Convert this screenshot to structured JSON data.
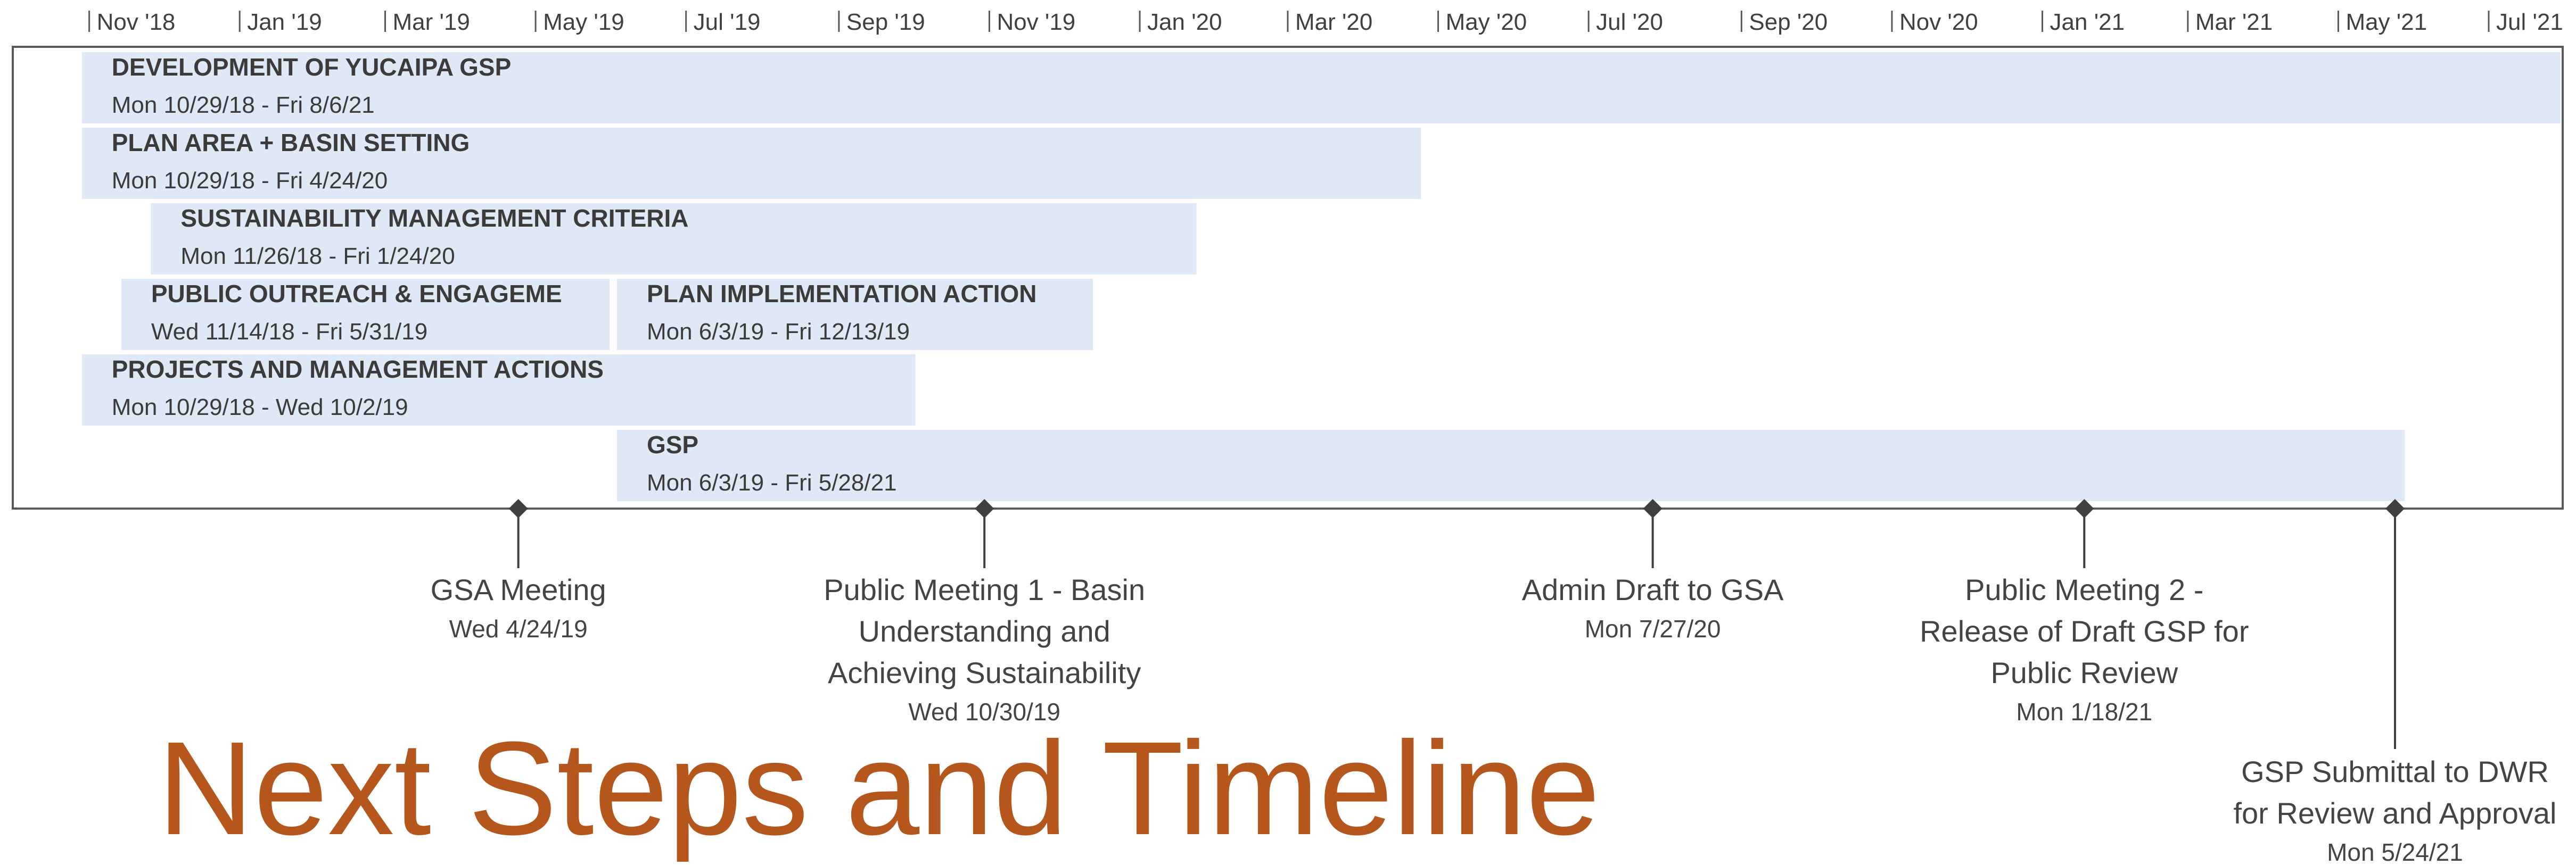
{
  "slide": {
    "title": "Next Steps and Timeline",
    "title_color": "#b5571c"
  },
  "chart_data": {
    "type": "timeline",
    "x_axis": {
      "start": "2018-10-01",
      "end": "2021-07-31",
      "ticks": [
        {
          "date": "2018-11-01",
          "label": "Nov '18"
        },
        {
          "date": "2019-01-01",
          "label": "Jan '19"
        },
        {
          "date": "2019-03-01",
          "label": "Mar '19"
        },
        {
          "date": "2019-05-01",
          "label": "May '19"
        },
        {
          "date": "2019-07-01",
          "label": "Jul '19"
        },
        {
          "date": "2019-09-01",
          "label": "Sep '19"
        },
        {
          "date": "2019-11-01",
          "label": "Nov '19"
        },
        {
          "date": "2020-01-01",
          "label": "Jan '20"
        },
        {
          "date": "2020-03-01",
          "label": "Mar '20"
        },
        {
          "date": "2020-05-01",
          "label": "May '20"
        },
        {
          "date": "2020-07-01",
          "label": "Jul '20"
        },
        {
          "date": "2020-09-01",
          "label": "Sep '20"
        },
        {
          "date": "2020-11-01",
          "label": "Nov '20"
        },
        {
          "date": "2021-01-01",
          "label": "Jan '21"
        },
        {
          "date": "2021-03-01",
          "label": "Mar '21"
        },
        {
          "date": "2021-05-01",
          "label": "May '21"
        },
        {
          "date": "2021-07-01",
          "label": "Jul '21"
        }
      ]
    },
    "tasks": [
      {
        "name": "DEVELOPMENT OF YUCAIPA GSP",
        "dates": "Mon 10/29/18 - Fri 8/6/21",
        "start": "2018-10-29",
        "end": "2021-08-06",
        "row": 0
      },
      {
        "name": "PLAN AREA + BASIN SETTING",
        "dates": "Mon 10/29/18 - Fri 4/24/20",
        "start": "2018-10-29",
        "end": "2020-04-24",
        "row": 1
      },
      {
        "name": "SUSTAINABILITY MANAGEMENT CRITERIA",
        "dates": "Mon 11/26/18 - Fri 1/24/20",
        "start": "2018-11-26",
        "end": "2020-01-24",
        "row": 2
      },
      {
        "name": "PUBLIC OUTREACH & ENGAGEME",
        "dates": "Wed 11/14/18 - Fri 5/31/19",
        "start": "2018-11-14",
        "end": "2019-05-31",
        "row": 3
      },
      {
        "name": "PLAN IMPLEMENTATION ACTION",
        "dates": "Mon 6/3/19 - Fri 12/13/19",
        "start": "2019-06-03",
        "end": "2019-12-13",
        "row": 3
      },
      {
        "name": "PROJECTS AND MANAGEMENT ACTIONS",
        "dates": "Mon 10/29/18 - Wed 10/2/19",
        "start": "2018-10-29",
        "end": "2019-10-02",
        "row": 4
      },
      {
        "name": "GSP",
        "dates": "Mon 6/3/19 - Fri 5/28/21",
        "start": "2019-06-03",
        "end": "2021-05-28",
        "row": 5
      }
    ],
    "milestones": [
      {
        "date": "2019-04-24",
        "name_lines": [
          "GSA Meeting"
        ],
        "date_label": "Wed 4/24/19",
        "level": 1
      },
      {
        "date": "2019-10-30",
        "name_lines": [
          "Public Meeting 1 - Basin",
          "Understanding and",
          "Achieving Sustainability"
        ],
        "date_label": "Wed 10/30/19",
        "level": 1
      },
      {
        "date": "2020-07-27",
        "name_lines": [
          "Admin Draft to GSA"
        ],
        "date_label": "Mon 7/27/20",
        "level": 1
      },
      {
        "date": "2021-01-18",
        "name_lines": [
          "Public Meeting 2 -",
          "Release of Draft GSP for",
          "Public Review"
        ],
        "date_label": "Mon 1/18/21",
        "level": 1
      },
      {
        "date": "2021-05-24",
        "name_lines": [
          "GSP Submittal to DWR",
          "for Review and Approval"
        ],
        "date_label": "Mon 5/24/21",
        "level": 2
      }
    ],
    "colors": {
      "bar_fill": "#dfe8f5",
      "text": "#3b3b3b",
      "axis": "#595959",
      "milestone": "#404040"
    }
  }
}
